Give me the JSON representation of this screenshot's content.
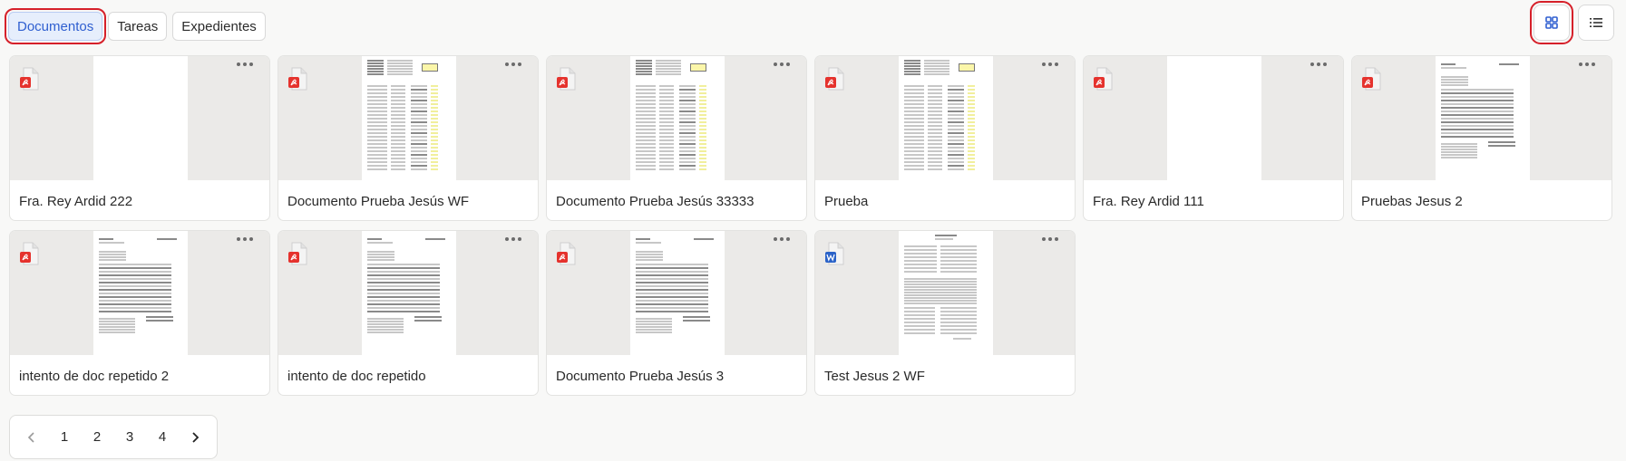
{
  "tabs": [
    {
      "label": "Documentos",
      "active": true
    },
    {
      "label": "Tareas",
      "active": false
    },
    {
      "label": "Expedientes",
      "active": false
    }
  ],
  "view_toggle": {
    "grid_icon": "grid-view-icon",
    "list_icon": "list-view-icon",
    "selected": "grid"
  },
  "documents": [
    {
      "title": "Fra. Rey Ardid 222",
      "file_type": "pdf",
      "thumbnail": "blank"
    },
    {
      "title": "Documento Prueba Jesús WF",
      "file_type": "pdf",
      "thumbnail": "table"
    },
    {
      "title": "Documento Prueba Jesús 33333",
      "file_type": "pdf",
      "thumbnail": "table"
    },
    {
      "title": "Prueba",
      "file_type": "pdf",
      "thumbnail": "table"
    },
    {
      "title": "Fra. Rey Ardid 111",
      "file_type": "pdf",
      "thumbnail": "blank"
    },
    {
      "title": "Pruebas Jesus 2",
      "file_type": "pdf",
      "thumbnail": "invoice"
    },
    {
      "title": "intento de doc repetido 2",
      "file_type": "pdf",
      "thumbnail": "invoice"
    },
    {
      "title": "intento de doc repetido",
      "file_type": "pdf",
      "thumbnail": "invoice"
    },
    {
      "title": "Documento Prueba Jesús 3",
      "file_type": "pdf",
      "thumbnail": "invoice"
    },
    {
      "title": "Test Jesus 2 WF",
      "file_type": "word",
      "thumbnail": "form"
    }
  ],
  "pagination": {
    "prev_icon": "chevron-left-icon",
    "next_icon": "chevron-right-icon",
    "pages": [
      "1",
      "2",
      "3",
      "4"
    ]
  },
  "colors": {
    "accent": "#2f5fd0",
    "highlight_outline": "#d6202a",
    "pdf_red": "#e5322d",
    "word_blue": "#2b63c8"
  }
}
